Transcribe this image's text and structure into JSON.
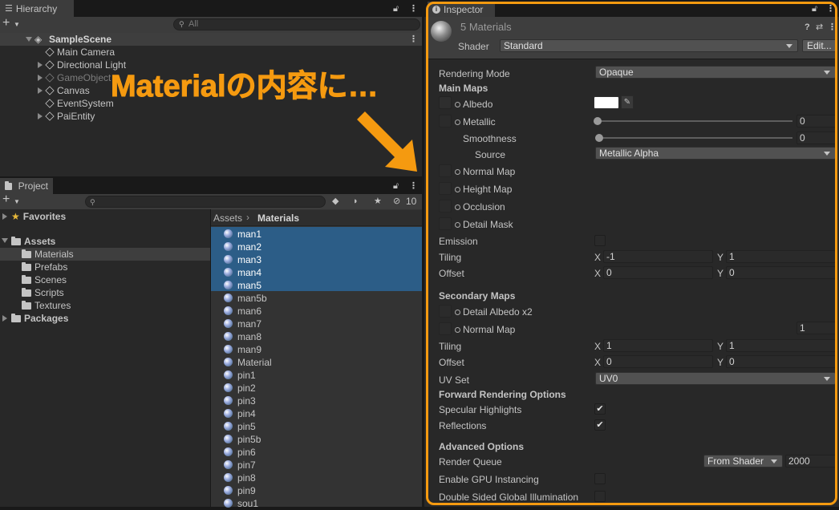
{
  "hierarchy": {
    "tab": "Hierarchy",
    "search_placeholder": "All",
    "scene": "SampleScene",
    "items": [
      "Main Camera",
      "Directional Light",
      "GameObject",
      "Canvas",
      "EventSystem",
      "PaiEntity"
    ]
  },
  "annotation": {
    "text": "Materialの内容に…",
    "color": "#f59a10"
  },
  "project": {
    "tab": "Project",
    "hidden_count": "10",
    "tree": {
      "favorites": "Favorites",
      "assets": "Assets",
      "folders": [
        "Materials",
        "Prefabs",
        "Scenes",
        "Scripts",
        "Textures"
      ],
      "packages": "Packages"
    },
    "breadcrumb": {
      "root": "Assets",
      "current": "Materials"
    },
    "files": [
      "man1",
      "man2",
      "man3",
      "man4",
      "man5",
      "man5b",
      "man6",
      "man7",
      "man8",
      "man9",
      "Material",
      "pin1",
      "pin2",
      "pin3",
      "pin4",
      "pin5",
      "pin5b",
      "pin6",
      "pin7",
      "pin8",
      "pin9",
      "sou1"
    ],
    "selected_count": 5
  },
  "inspector": {
    "tab": "Inspector",
    "title": "5 Materials",
    "shader_label": "Shader",
    "shader_value": "Standard",
    "edit_label": "Edit...",
    "rendering_mode_label": "Rendering Mode",
    "rendering_mode_value": "Opaque",
    "main_maps": "Main Maps",
    "albedo": "Albedo",
    "metallic": "Metallic",
    "metallic_value": "0",
    "smoothness": "Smoothness",
    "smoothness_value": "0",
    "source": "Source",
    "source_value": "Metallic Alpha",
    "normal_map": "Normal Map",
    "height_map": "Height Map",
    "occlusion": "Occlusion",
    "detail_mask": "Detail Mask",
    "emission": "Emission",
    "tiling": "Tiling",
    "offset": "Offset",
    "x": "X",
    "y": "Y",
    "main_tiling_x": "-1",
    "main_tiling_y": "1",
    "main_offset_x": "0",
    "main_offset_y": "0",
    "secondary_maps": "Secondary Maps",
    "detail_albedo": "Detail Albedo x2",
    "normal_map2": "Normal Map",
    "normal_map2_value": "1",
    "sec_tiling_x": "1",
    "sec_tiling_y": "1",
    "sec_offset_x": "0",
    "sec_offset_y": "0",
    "uv_set": "UV Set",
    "uv_set_value": "UV0",
    "forward_options": "Forward Rendering Options",
    "specular_highlights": "Specular Highlights",
    "reflections": "Reflections",
    "advanced_options": "Advanced Options",
    "render_queue": "Render Queue",
    "render_queue_mode": "From Shader",
    "render_queue_value": "2000",
    "gpu_instancing": "Enable GPU Instancing",
    "double_sided": "Double Sided Global Illumination"
  },
  "colors": {
    "highlight_border": "#f59a10",
    "selection": "#2c5d87"
  }
}
